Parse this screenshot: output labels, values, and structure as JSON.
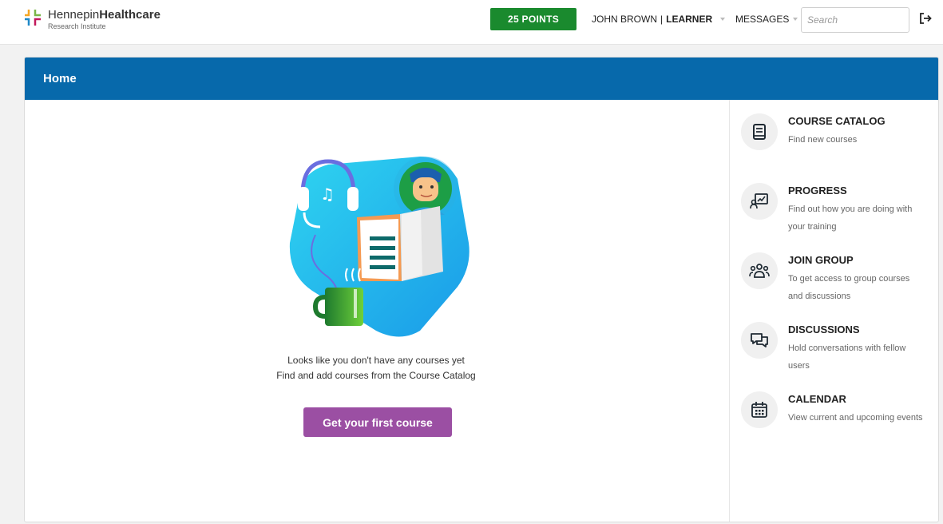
{
  "header": {
    "logo_name_light": "Hennepin",
    "logo_name_bold": "Healthcare",
    "logo_sub": "Research Institute",
    "points": "25 POINTS",
    "user_name": "JOHN BROWN",
    "user_sep": "|",
    "user_role": "LEARNER",
    "messages": "MESSAGES",
    "search_placeholder": "Search"
  },
  "page": {
    "title": "Home",
    "empty_line1": "Looks like you don't have any courses yet",
    "empty_line2": "Find and add courses from the Course Catalog",
    "cta": "Get your first course"
  },
  "menu": [
    {
      "title": "COURSE CATALOG",
      "desc": "Find new courses",
      "icon": "book-icon"
    },
    {
      "title": "PROGRESS",
      "desc": "Find out how you are doing with your training",
      "icon": "progress-icon"
    },
    {
      "title": "JOIN GROUP",
      "desc": "To get access to group courses and discussions",
      "icon": "group-icon"
    },
    {
      "title": "DISCUSSIONS",
      "desc": "Hold conversations with fellow users",
      "icon": "chat-icon"
    },
    {
      "title": "CALENDAR",
      "desc": "View current and upcoming events",
      "icon": "calendar-icon"
    }
  ],
  "colors": {
    "brand_blue": "#0769ab",
    "points_green": "#1a8a2e",
    "cta_purple": "#9b4fa3"
  }
}
